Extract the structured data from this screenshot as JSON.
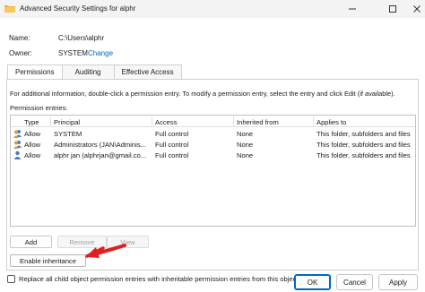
{
  "window": {
    "title": "Advanced Security Settings for alphr",
    "icon": "folder-icon",
    "accent": "#0067c0",
    "folder_color": "#e8b84a"
  },
  "general": {
    "name_label": "Name:",
    "name_value": "C:\\Users\\alphr",
    "owner_label": "Owner:",
    "owner_value": "SYSTEM",
    "change_link": "Change"
  },
  "tabs": [
    {
      "label": "Permissions",
      "active": true
    },
    {
      "label": "Auditing",
      "active": false
    },
    {
      "label": "Effective Access",
      "active": false
    }
  ],
  "permissions": {
    "info_text": "For additional information, double-click a permission entry. To modify a permission entry, select the entry and click Edit (if available).",
    "entries_label": "Permission entries:",
    "columns": [
      "Type",
      "Principal",
      "Access",
      "Inherited from",
      "Applies to"
    ],
    "rows": [
      {
        "icon": "users-icon",
        "type": "Allow",
        "principal": "SYSTEM",
        "access": "Full control",
        "inherited": "None",
        "applies": "This folder, subfolders and files"
      },
      {
        "icon": "users-icon",
        "type": "Allow",
        "principal": "Administrators (JAN\\Adminis...",
        "access": "Full control",
        "inherited": "None",
        "applies": "This folder, subfolders and files"
      },
      {
        "icon": "user-icon",
        "type": "Allow",
        "principal": "alphr jan (alphrjan@gmail.co...",
        "access": "Full control",
        "inherited": "None",
        "applies": "This folder, subfolders and files"
      }
    ],
    "add_button": "Add",
    "remove_button": "Remove",
    "view_button": "View",
    "enable_inheritance_button": "Enable inheritance",
    "replace_checkbox_label": "Replace all child object permission entries with inheritable permission entries from this object",
    "replace_checked": false
  },
  "annotation": {
    "color": "#e02020"
  },
  "footer": {
    "ok": "OK",
    "cancel": "Cancel",
    "apply": "Apply"
  }
}
